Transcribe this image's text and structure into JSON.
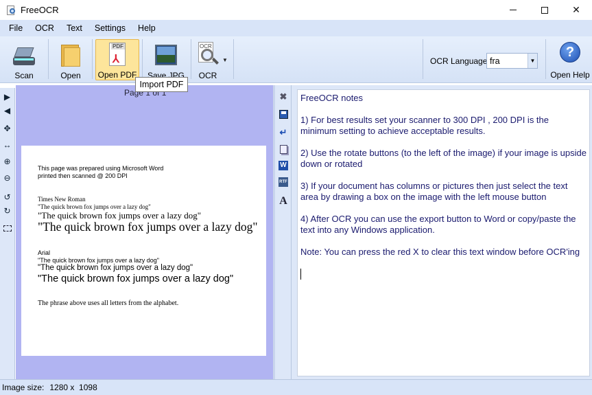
{
  "window": {
    "title": "FreeOCR",
    "controls": [
      "minimize",
      "maximize",
      "close"
    ]
  },
  "menu": [
    "File",
    "OCR",
    "Text",
    "Settings",
    "Help"
  ],
  "toolbar": {
    "scan_label": "Scan",
    "open_label": "Open",
    "open_pdf_label": "Open PDF",
    "save_jpg_label": "Save JPG",
    "ocr_label": "OCR",
    "ocr_language_label": "OCR Language:",
    "ocr_language_value": "fra",
    "open_help_label": "Open Help",
    "tooltip": "Import PDF"
  },
  "image_panel": {
    "page_indicator": "Page 1 of 1",
    "page_lines": [
      "This page was prepared using Microsoft Word",
      "printed then scanned @ 200 DPI",
      "Times New Roman",
      "\"The quick brown fox jumps over a lazy dog\"",
      "\"The quick brown fox jumps over a lazy dog\"",
      "\"The quick brown fox jumps over a lazy dog\"",
      "Arial",
      "\"The quick brown fox jumps over a lazy dog\"",
      "\"The quick brown fox jumps over a lazy dog\"",
      "\"The quick brown fox jumps over a lazy dog\"",
      "The phrase above uses all letters from the alphabet."
    ]
  },
  "text_panel": {
    "paragraphs": [
      "FreeOCR notes",
      "1) For best results set your scanner to 300 DPI , 200 DPI is the minimum setting to achieve acceptable results.",
      "2) Use the rotate buttons (to the left of the image) if your image is upside down or rotated",
      "3) If your document has columns or pictures then just select the text area by drawing a box on the image with the left mouse button",
      "4) After OCR you can use the export button to Word or copy/paste the text into any Windows application.",
      "Note: You can press the red X to clear this text window before OCR'ing"
    ]
  },
  "status": {
    "label": "Image size:",
    "value": "1280 x  1098"
  }
}
